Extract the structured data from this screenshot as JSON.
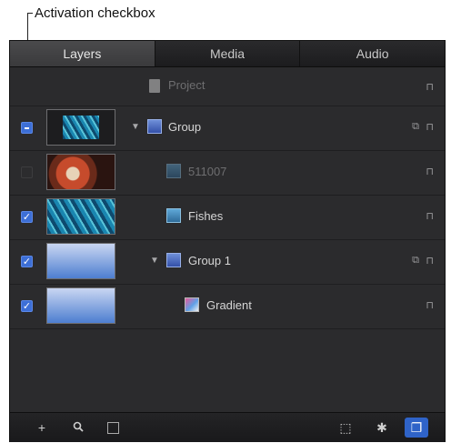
{
  "callout": {
    "label": "Activation checkbox"
  },
  "tabs": [
    {
      "label": "Layers",
      "active": true
    },
    {
      "label": "Media",
      "active": false
    },
    {
      "label": "Audio",
      "active": false
    }
  ],
  "layers": [
    {
      "name": "Project",
      "checkbox": "none",
      "dimmed": true
    },
    {
      "name": "Group",
      "checkbox": "mixed",
      "dimmed": false
    },
    {
      "name": "511007",
      "checkbox": "off",
      "dimmed": true
    },
    {
      "name": "Fishes",
      "checkbox": "on",
      "dimmed": false
    },
    {
      "name": "Group 1",
      "checkbox": "on",
      "dimmed": false
    },
    {
      "name": "Gradient",
      "checkbox": "on",
      "dimmed": false
    }
  ],
  "icons": {
    "lock": "lock-icon",
    "stack": "stack-icon",
    "disclosure": "disclosure-triangle-icon"
  },
  "toolbar": {
    "add": "+",
    "search": "🔍"
  },
  "colors": {
    "accent": "#3d6fd6",
    "panel": "#2b2b2d"
  }
}
